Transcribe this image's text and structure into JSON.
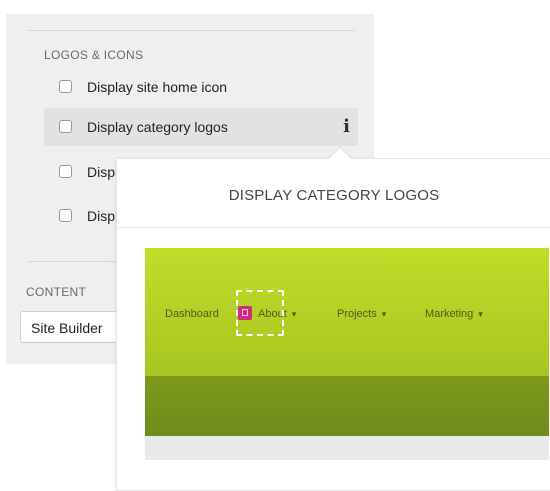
{
  "settings": {
    "logos_section": {
      "heading": "LOGOS & ICONS",
      "options": [
        {
          "label": "Display site home icon",
          "checked": false
        },
        {
          "label": "Display category logos",
          "checked": false
        },
        {
          "label": "Displa",
          "checked": false
        },
        {
          "label": "Displa",
          "checked": false
        }
      ],
      "info_icon": "info-icon"
    },
    "content_section": {
      "heading": "CONTENT",
      "select_value": "Site Builder"
    }
  },
  "tooltip": {
    "title": "DISPLAY CATEGORY LOGOS",
    "preview": {
      "nav_items": [
        {
          "label": "Dashboard",
          "has_caret": false
        },
        {
          "label": "About",
          "has_caret": true
        },
        {
          "label": "Projects",
          "has_caret": true
        },
        {
          "label": "Marketing",
          "has_caret": true
        }
      ],
      "caret_glyph": "▾",
      "colors": {
        "header": "#b8d327",
        "band": "#779419",
        "logo": "#d12c7b"
      }
    }
  }
}
